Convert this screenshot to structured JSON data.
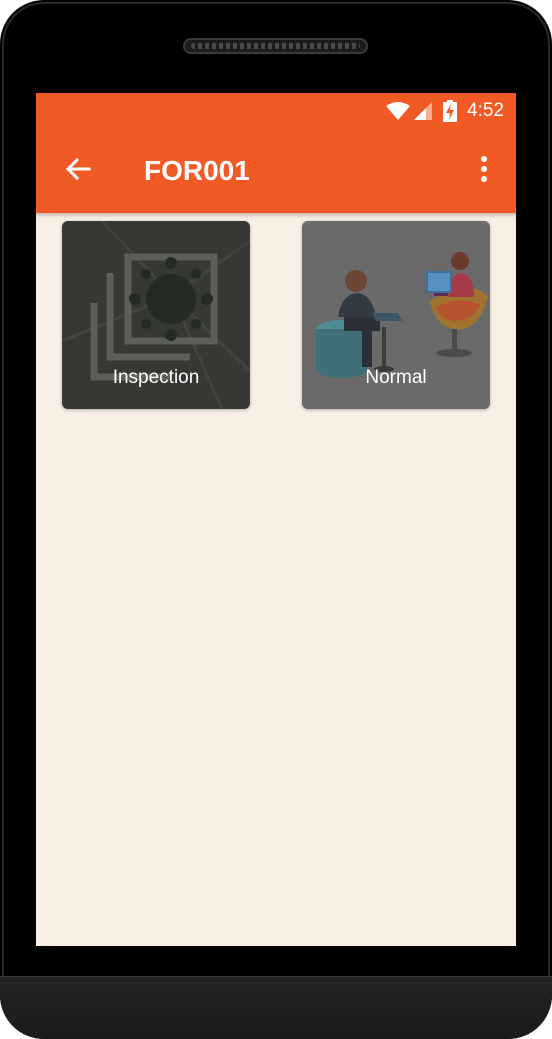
{
  "status_bar": {
    "time": "4:52",
    "icons": [
      "wifi-icon",
      "cell-signal-icon",
      "battery-charging-icon"
    ]
  },
  "app_bar": {
    "title": "FOR001",
    "back_icon": "arrow-left-icon",
    "menu_icon": "more-vert-icon",
    "color": "#f15a24"
  },
  "tiles": [
    {
      "label": "Inspection",
      "image": "inspection-art"
    },
    {
      "label": "Normal",
      "image": "office-workers-art"
    }
  ],
  "colors": {
    "accent": "#f15a24",
    "background": "#f9efe5"
  }
}
